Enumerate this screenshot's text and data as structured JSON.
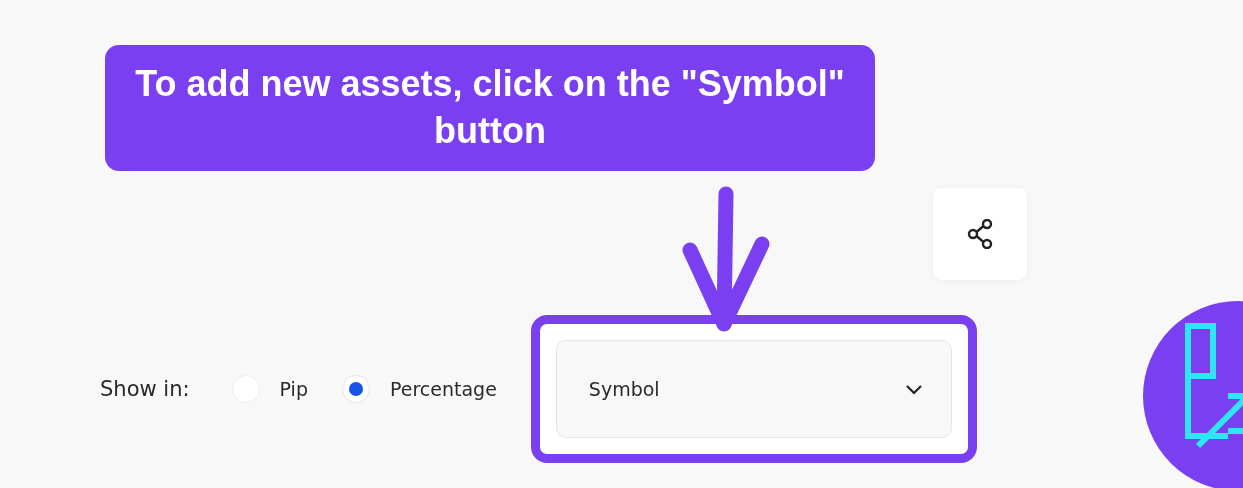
{
  "callout": {
    "text": "To add new assets, click on the \"Symbol\" button"
  },
  "show_in": {
    "label": "Show in:",
    "options": [
      {
        "label": "Pip",
        "selected": false
      },
      {
        "label": "Percentage",
        "selected": true
      }
    ]
  },
  "symbol_select": {
    "value": "Symbol",
    "highlighted": true
  }
}
